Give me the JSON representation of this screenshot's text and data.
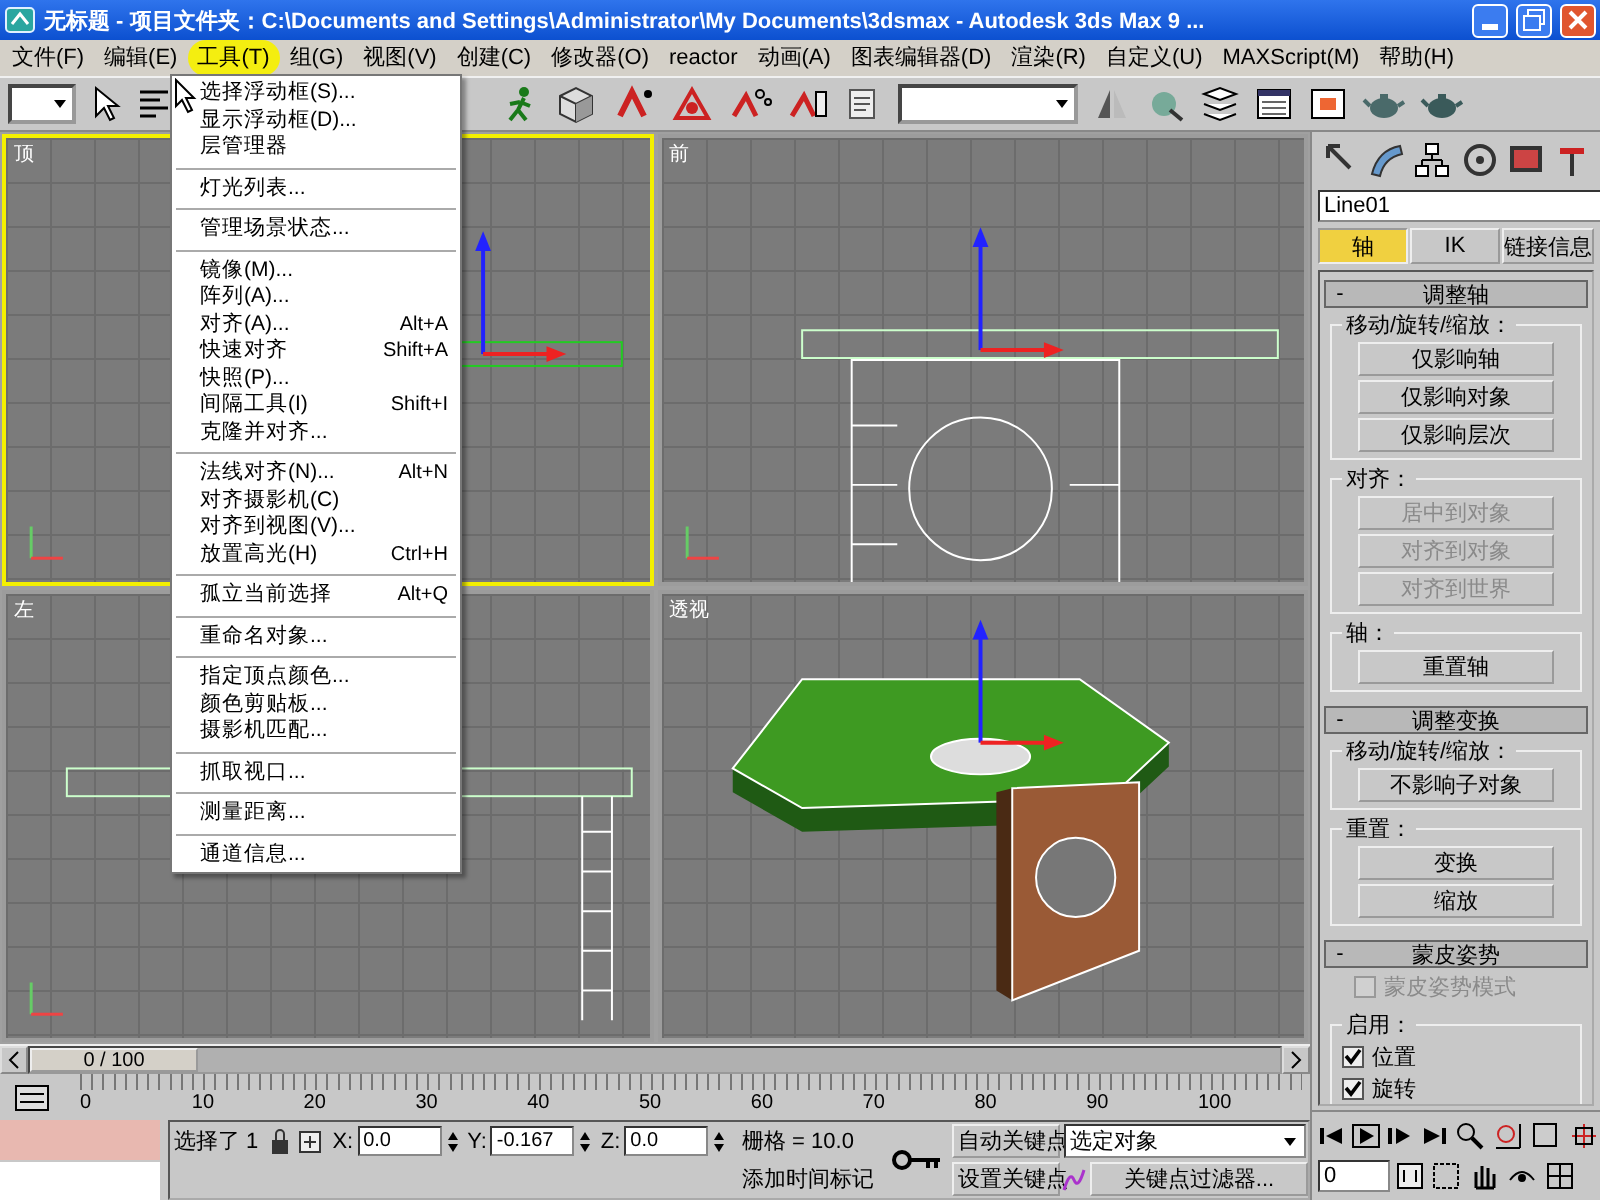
{
  "window": {
    "title": "无标题  - 项目文件夹：C:\\Documents and Settings\\Administrator\\My Documents\\3dsmax  - Autodesk 3ds Max 9  ..."
  },
  "menu_bar": [
    {
      "label": "文件(F)",
      "selected": false
    },
    {
      "label": "编辑(E)",
      "selected": false
    },
    {
      "label": "工具(T)",
      "selected": true
    },
    {
      "label": "组(G)",
      "selected": false
    },
    {
      "label": "视图(V)",
      "selected": false
    },
    {
      "label": "创建(C)",
      "selected": false
    },
    {
      "label": "修改器(O)",
      "selected": false
    },
    {
      "label": "reactor",
      "selected": false
    },
    {
      "label": "动画(A)",
      "selected": false
    },
    {
      "label": "图表编辑器(D)",
      "selected": false
    },
    {
      "label": "渲染(R)",
      "selected": false
    },
    {
      "label": "自定义(U)",
      "selected": false
    },
    {
      "label": "MAXScript(M)",
      "selected": false
    },
    {
      "label": "帮助(H)",
      "selected": false
    }
  ],
  "tools_menu": {
    "groups": [
      [
        {
          "label": "选择浮动框(S)..."
        },
        {
          "label": "显示浮动框(D)..."
        },
        {
          "label": "层管理器"
        }
      ],
      [
        {
          "label": "灯光列表..."
        }
      ],
      [
        {
          "label": "管理场景状态..."
        }
      ],
      [
        {
          "label": "镜像(M)..."
        },
        {
          "label": "阵列(A)..."
        },
        {
          "label": "对齐(A)...",
          "shortcut": "Alt+A"
        },
        {
          "label": "快速对齐",
          "shortcut": "Shift+A"
        },
        {
          "label": "快照(P)..."
        },
        {
          "label": "间隔工具(I)",
          "shortcut": "Shift+I"
        },
        {
          "label": "克隆并对齐..."
        }
      ],
      [
        {
          "label": "法线对齐(N)...",
          "shortcut": "Alt+N"
        },
        {
          "label": "对齐摄影机(C)"
        },
        {
          "label": "对齐到视图(V)..."
        },
        {
          "label": "放置高光(H)",
          "shortcut": "Ctrl+H"
        }
      ],
      [
        {
          "label": "孤立当前选择",
          "shortcut": "Alt+Q"
        }
      ],
      [
        {
          "label": "重命名对象..."
        }
      ],
      [
        {
          "label": "指定顶点颜色..."
        },
        {
          "label": "颜色剪贴板..."
        },
        {
          "label": "摄影机匹配..."
        }
      ],
      [
        {
          "label": "抓取视口..."
        }
      ],
      [
        {
          "label": "测量距离..."
        }
      ],
      [
        {
          "label": "通道信息..."
        }
      ]
    ]
  },
  "viewports": [
    {
      "label": "顶",
      "kind": "top",
      "selected": true
    },
    {
      "label": "前",
      "kind": "front",
      "selected": false
    },
    {
      "label": "左",
      "kind": "left",
      "selected": false
    },
    {
      "label": "透视",
      "kind": "perspective",
      "selected": false
    }
  ],
  "command_panel": {
    "object_name": "Line01",
    "tabs": [
      {
        "label": "轴",
        "selected": true
      },
      {
        "label": "IK",
        "selected": false
      },
      {
        "label": "链接信息",
        "selected": false
      }
    ],
    "rollouts": [
      {
        "sign": "-",
        "title": "调整轴",
        "groups": [
          {
            "title": "移动/旋转/缩放：",
            "controls": [
              {
                "kind": "button",
                "label": "仅影响轴",
                "disabled": false
              },
              {
                "kind": "button",
                "label": "仅影响对象",
                "disabled": false
              },
              {
                "kind": "button",
                "label": "仅影响层次",
                "disabled": false
              }
            ]
          },
          {
            "title": "对齐：",
            "controls": [
              {
                "kind": "button",
                "label": "居中到对象",
                "disabled": true
              },
              {
                "kind": "button",
                "label": "对齐到对象",
                "disabled": true
              },
              {
                "kind": "button",
                "label": "对齐到世界",
                "disabled": true
              }
            ]
          },
          {
            "title": "轴：",
            "controls": [
              {
                "kind": "button",
                "label": "重置轴",
                "disabled": false
              }
            ]
          }
        ]
      },
      {
        "sign": "-",
        "title": "调整变换",
        "groups": [
          {
            "title": "移动/旋转/缩放：",
            "controls": [
              {
                "kind": "button",
                "label": "不影响子对象",
                "disabled": false
              }
            ]
          },
          {
            "title": "重置：",
            "controls": [
              {
                "kind": "button",
                "label": "变换",
                "disabled": false
              },
              {
                "kind": "button",
                "label": "缩放",
                "disabled": false
              }
            ]
          }
        ]
      },
      {
        "sign": "-",
        "title": "蒙皮姿势",
        "groups": [
          {
            "controls": [
              {
                "kind": "checkbox",
                "label": "蒙皮姿势模式",
                "checked": false,
                "disabled": true
              }
            ]
          },
          {
            "title": "启用：",
            "controls": [
              {
                "kind": "checkbox",
                "label": "位置",
                "checked": true,
                "disabled": false
              },
              {
                "kind": "checkbox",
                "label": "旋转",
                "checked": true,
                "disabled": false
              }
            ]
          }
        ]
      }
    ]
  },
  "time_slider": {
    "label": "0 / 100",
    "level": 0
  },
  "track_bar": {
    "ticks": [
      "0",
      "10",
      "20",
      "30",
      "40",
      "50",
      "60",
      "70",
      "80",
      "90",
      "100"
    ]
  },
  "status_bar": {
    "selection": "选择了 1",
    "coordinates": [
      {
        "axis": "X:",
        "value": "0.0"
      },
      {
        "axis": "Y:",
        "value": "-0.167"
      },
      {
        "axis": "Z:",
        "value": "0.0"
      }
    ],
    "grid": "栅格 = 10.0",
    "time_tag": "添加时间标记",
    "auto_key": "自动关键点",
    "set_key": "设置关键点",
    "key_mode": "选定对象",
    "key_filters": "关键点过滤器...",
    "frame": "0"
  }
}
